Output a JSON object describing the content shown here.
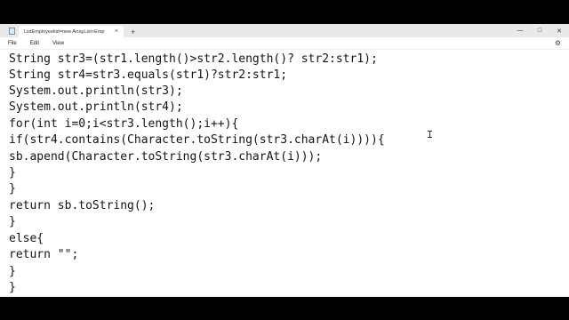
{
  "window": {
    "tab_title": "ListEmployeelist=new ArrayList<Emp",
    "tab_close": "×",
    "new_tab": "+",
    "controls": {
      "minimize": "—",
      "maximize": "□",
      "close": "✕"
    }
  },
  "menu": {
    "items": [
      "File",
      "Edit",
      "View"
    ],
    "settings_icon": "⚙"
  },
  "editor": {
    "lines": [
      "String str3=(str1.length()>str2.length()? str2:str1);",
      "String str4=str3.equals(str1)?str2:str1;",
      "System.out.println(str3);",
      "System.out.println(str4);",
      "for(int i=0;i<str3.length();i++){",
      "if(str4.contains(Character.toString(str3.charAt(i)))){",
      "sb.apend(Character.toString(str3.charAt(i)));",
      "}",
      "}",
      "return sb.toString();",
      "}",
      "else{",
      "return \"\";",
      "}",
      "}"
    ]
  }
}
